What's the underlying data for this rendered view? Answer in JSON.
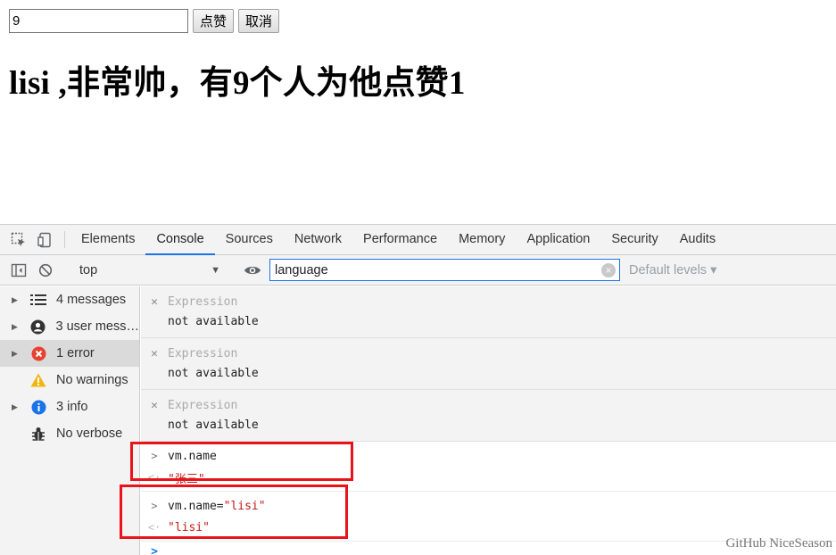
{
  "page": {
    "input_value": "9",
    "like_button": "点赞",
    "cancel_button": "取消",
    "heading": "lisi ,非常帅，有9个人为他点赞1"
  },
  "devtools": {
    "tabs": [
      {
        "label": "Elements",
        "active": false
      },
      {
        "label": "Console",
        "active": true
      },
      {
        "label": "Sources",
        "active": false
      },
      {
        "label": "Network",
        "active": false
      },
      {
        "label": "Performance",
        "active": false
      },
      {
        "label": "Memory",
        "active": false
      },
      {
        "label": "Application",
        "active": false
      },
      {
        "label": "Security",
        "active": false
      },
      {
        "label": "Audits",
        "active": false
      }
    ],
    "toolbar": {
      "context": "top",
      "filter_value": "language",
      "levels": "Default levels"
    },
    "sidebar": [
      {
        "label": "4 messages",
        "icon": "list-icon",
        "expandable": true,
        "selected": false
      },
      {
        "label": "3 user mess…",
        "icon": "user-icon",
        "expandable": true,
        "selected": false
      },
      {
        "label": "1 error",
        "icon": "error-icon",
        "expandable": true,
        "selected": true
      },
      {
        "label": "No warnings",
        "icon": "warning-icon",
        "expandable": false,
        "selected": false
      },
      {
        "label": "3 info",
        "icon": "info-icon",
        "expandable": true,
        "selected": false
      },
      {
        "label": "No verbose",
        "icon": "bug-icon",
        "expandable": false,
        "selected": false
      }
    ],
    "expressions": [
      {
        "name": "Expression",
        "value": "not available"
      },
      {
        "name": "Expression",
        "value": "not available"
      },
      {
        "name": "Expression",
        "value": "not available"
      }
    ],
    "console_entries": [
      {
        "input": "vm.name",
        "input_string": "",
        "result": "\"张三\""
      },
      {
        "input": "vm.name=",
        "input_string": "\"lisi\"",
        "result": "\"lisi\""
      }
    ],
    "colors": {
      "accent": "#1a73e8",
      "string": "#c41a16",
      "highlight": "#e8141b",
      "error": "#e8412f",
      "warning": "#f2b50f",
      "info": "#1a73e8"
    }
  },
  "watermark": "GitHub NiceSeason"
}
